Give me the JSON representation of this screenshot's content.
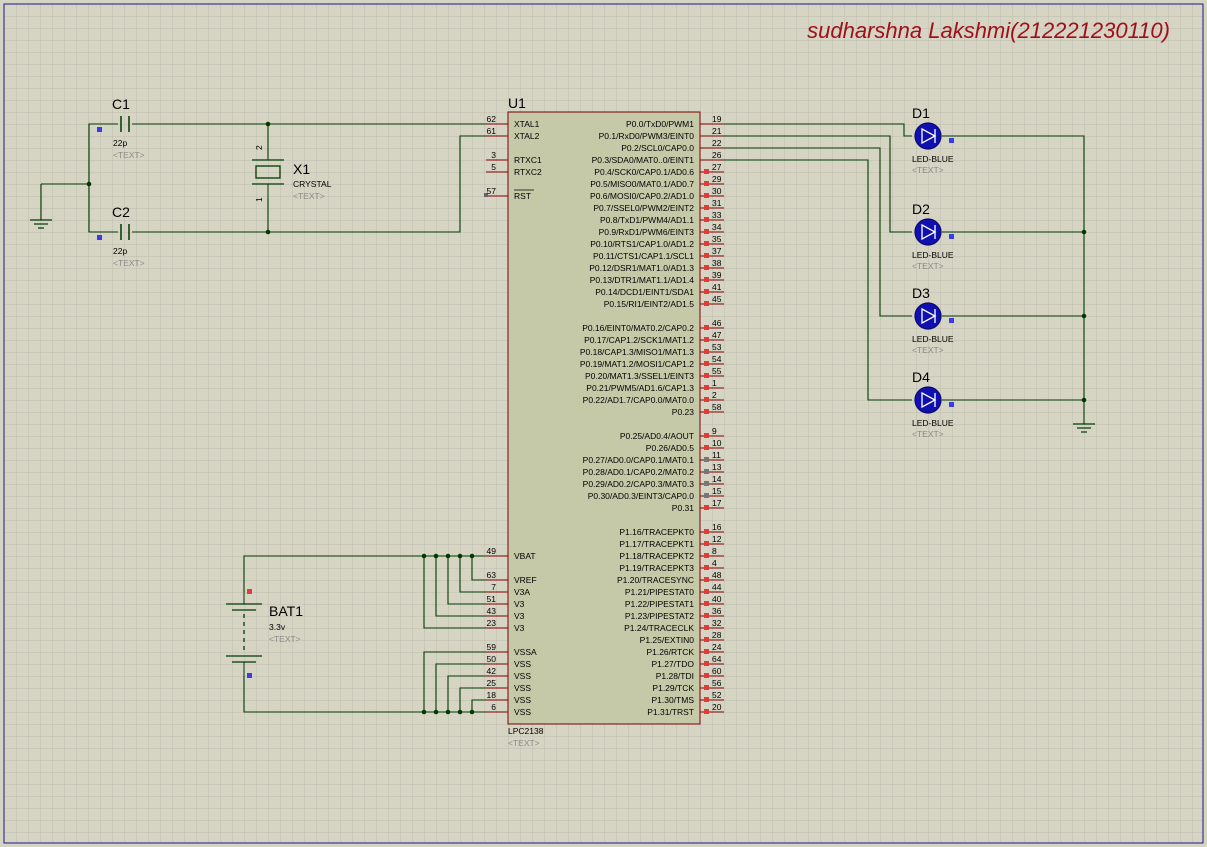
{
  "title": "sudharshna Lakshmi(212221230110)",
  "colors": {
    "background": "#d6d4c3",
    "grid": "#bdbcae",
    "wire": "#003a00",
    "chip_fill": "#c6c9a8",
    "chip_border": "#7a0000",
    "led_blue": "#1010b0",
    "title_red": "#a0101a",
    "pin_marker_red": "#e53a3a",
    "pin_marker_blue": "#3a3aee"
  },
  "components": {
    "u1": {
      "ref": "U1",
      "part": "LPC2138",
      "text": "<TEXT>",
      "left_pins": [
        {
          "num": "62",
          "name": "XTAL1"
        },
        {
          "num": "61",
          "name": "XTAL2"
        },
        {
          "num": "3",
          "name": "RTXC1"
        },
        {
          "num": "5",
          "name": "RTXC2"
        },
        {
          "num": "57",
          "name": "RST"
        },
        {
          "num": "49",
          "name": "VBAT"
        },
        {
          "num": "63",
          "name": "VREF"
        },
        {
          "num": "7",
          "name": "V3A"
        },
        {
          "num": "51",
          "name": "V3"
        },
        {
          "num": "43",
          "name": "V3"
        },
        {
          "num": "23",
          "name": "V3"
        },
        {
          "num": "59",
          "name": "VSSA"
        },
        {
          "num": "50",
          "name": "VSS"
        },
        {
          "num": "42",
          "name": "VSS"
        },
        {
          "num": "25",
          "name": "VSS"
        },
        {
          "num": "18",
          "name": "VSS"
        },
        {
          "num": "6",
          "name": "VSS"
        }
      ],
      "right_pins": [
        {
          "num": "19",
          "name": "P0.0/TxD0/PWM1"
        },
        {
          "num": "21",
          "name": "P0.1/RxD0/PWM3/EINT0"
        },
        {
          "num": "22",
          "name": "P0.2/SCL0/CAP0.0"
        },
        {
          "num": "26",
          "name": "P0.3/SDA0/MAT0..0/EINT1"
        },
        {
          "num": "27",
          "name": "P0.4/SCK0/CAP0.1/AD0.6"
        },
        {
          "num": "29",
          "name": "P0.5/MISO0/MAT0.1/AD0.7"
        },
        {
          "num": "30",
          "name": "P0.6/MOSI0/CAP0.2/AD1.0"
        },
        {
          "num": "31",
          "name": "P0.7/SSEL0/PWM2/EINT2"
        },
        {
          "num": "33",
          "name": "P0.8/TxD1/PWM4/AD1.1"
        },
        {
          "num": "34",
          "name": "P0.9/RxD1/PWM6/EINT3"
        },
        {
          "num": "35",
          "name": "P0.10/RTS1/CAP1.0/AD1.2"
        },
        {
          "num": "37",
          "name": "P0.11/CTS1/CAP1.1/SCL1"
        },
        {
          "num": "38",
          "name": "P0.12/DSR1/MAT1.0/AD1.3"
        },
        {
          "num": "39",
          "name": "P0.13/DTR1/MAT1.1/AD1.4"
        },
        {
          "num": "41",
          "name": "P0.14/DCD1/EINT1/SDA1"
        },
        {
          "num": "45",
          "name": "P0.15/RI1/EINT2/AD1.5"
        },
        {
          "num": "46",
          "name": "P0.16/EINT0/MAT0.2/CAP0.2"
        },
        {
          "num": "47",
          "name": "P0.17/CAP1.2/SCK1/MAT1.2"
        },
        {
          "num": "53",
          "name": "P0.18/CAP1.3/MISO1/MAT1.3"
        },
        {
          "num": "54",
          "name": "P0.19/MAT1.2/MOSI1/CAP1.2"
        },
        {
          "num": "55",
          "name": "P0.20/MAT1.3/SSEL1/EINT3"
        },
        {
          "num": "1",
          "name": "P0.21/PWM5/AD1.6/CAP1.3"
        },
        {
          "num": "2",
          "name": "P0.22/AD1.7/CAP0.0/MAT0.0"
        },
        {
          "num": "58",
          "name": "P0.23"
        },
        {
          "num": "9",
          "name": "P0.25/AD0.4/AOUT"
        },
        {
          "num": "10",
          "name": "P0.26/AD0.5"
        },
        {
          "num": "11",
          "name": "P0.27/AD0.0/CAP0.1/MAT0.1"
        },
        {
          "num": "13",
          "name": "P0.28/AD0.1/CAP0.2/MAT0.2"
        },
        {
          "num": "14",
          "name": "P0.29/AD0.2/CAP0.3/MAT0.3"
        },
        {
          "num": "15",
          "name": "P0.30/AD0.3/EINT3/CAP0.0"
        },
        {
          "num": "17",
          "name": "P0.31"
        },
        {
          "num": "16",
          "name": "P1.16/TRACEPKT0"
        },
        {
          "num": "12",
          "name": "P1.17/TRACEPKT1"
        },
        {
          "num": "8",
          "name": "P1.18/TRACEPKT2"
        },
        {
          "num": "4",
          "name": "P1.19/TRACEPKT3"
        },
        {
          "num": "48",
          "name": "P1.20/TRACESYNC"
        },
        {
          "num": "44",
          "name": "P1.21/PIPESTAT0"
        },
        {
          "num": "40",
          "name": "P1.22/PIPESTAT1"
        },
        {
          "num": "36",
          "name": "P1.23/PIPESTAT2"
        },
        {
          "num": "32",
          "name": "P1.24/TRACECLK"
        },
        {
          "num": "28",
          "name": "P1.25/EXTIN0"
        },
        {
          "num": "24",
          "name": "P1.26/RTCK"
        },
        {
          "num": "64",
          "name": "P1.27/TDO"
        },
        {
          "num": "60",
          "name": "P1.28/TDI"
        },
        {
          "num": "56",
          "name": "P1.29/TCK"
        },
        {
          "num": "52",
          "name": "P1.30/TMS"
        },
        {
          "num": "20",
          "name": "P1.31/TRST"
        }
      ]
    },
    "c1": {
      "ref": "C1",
      "value": "22p",
      "text": "<TEXT>"
    },
    "c2": {
      "ref": "C2",
      "value": "22p",
      "text": "<TEXT>"
    },
    "x1": {
      "ref": "X1",
      "value": "CRYSTAL",
      "text": "<TEXT>",
      "pin_top": "2",
      "pin_bottom": "1"
    },
    "bat1": {
      "ref": "BAT1",
      "value": "3.3v",
      "text": "<TEXT>"
    },
    "leds": [
      {
        "ref": "D1",
        "value": "LED-BLUE",
        "text": "<TEXT>"
      },
      {
        "ref": "D2",
        "value": "LED-BLUE",
        "text": "<TEXT>"
      },
      {
        "ref": "D3",
        "value": "LED-BLUE",
        "text": "<TEXT>"
      },
      {
        "ref": "D4",
        "value": "LED-BLUE",
        "text": "<TEXT>"
      }
    ]
  }
}
